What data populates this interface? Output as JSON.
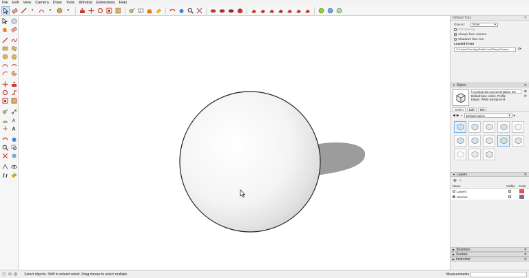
{
  "menu": [
    "File",
    "Edit",
    "View",
    "Camera",
    "Draw",
    "Tools",
    "Window",
    "Extensions",
    "Help"
  ],
  "tray": {
    "title": "Default Tray",
    "glue_to_label": "Glue to:",
    "glue_to_value": "None",
    "cut_opening": "Cut opening",
    "always_face_camera": "Always face camera",
    "shadows_face_sun": "Shadows face sun",
    "loaded_from_label": "Loaded From",
    "loaded_from_path": "C:\\Users\\Toru\\AppData\\Local\\Temp\\Comps"
  },
  "styles": {
    "header": "Styles",
    "style_name": "Construction Documentation Sty",
    "style_desc": "Default face colors. Profile Edges. White background.",
    "tabs": [
      "Select",
      "Edit",
      "Mix"
    ],
    "collection": "Default Styles"
  },
  "layers": {
    "header": "Layers",
    "col_name": "Name",
    "col_visible": "Visible",
    "col_color": "Color",
    "rows": [
      {
        "name": "Layer0",
        "visible": true,
        "color": "#e8504a"
      },
      {
        "name": "Voronoi",
        "visible": true,
        "color": "#7a6e8e"
      }
    ]
  },
  "collapsed_panels": [
    "Shadows",
    "Scenes",
    "Instructor"
  ],
  "status": {
    "message": "Select objects. Shift to extend select. Drag mouse to select multiple.",
    "measurements_label": "Measurements"
  },
  "colors": {
    "accent": "#3b86d6",
    "layer0": "#e8504a",
    "voronoi": "#7a6e8e"
  }
}
